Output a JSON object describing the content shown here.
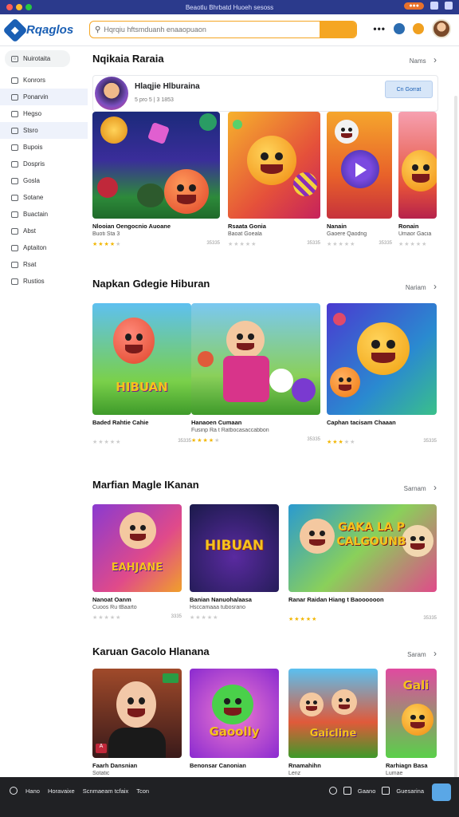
{
  "titlebar": {
    "title": "Beaotlu Bhrbatd Huoeh sesoss"
  },
  "header": {
    "logo": "Rqaglos",
    "search_placeholder": "Hqrqiu hftsmduanh enaaopuaon",
    "menu": "•••"
  },
  "sidebar": {
    "items": [
      {
        "label": "Nuirotaita",
        "icon": "search-icon"
      },
      {
        "label": "Konrors",
        "icon": "grid-icon"
      },
      {
        "label": "Ponarvin",
        "icon": "folder-icon"
      },
      {
        "label": "Hegso",
        "icon": "tag-icon"
      },
      {
        "label": "Stsro",
        "icon": "list-icon"
      },
      {
        "label": "Bupois",
        "icon": "doc-icon"
      },
      {
        "label": "Dospris",
        "icon": "doc-icon"
      },
      {
        "label": "Gosla",
        "icon": "settings-icon"
      },
      {
        "label": "Sotane",
        "icon": "star-icon"
      },
      {
        "label": "Buactain",
        "icon": "chart-icon"
      },
      {
        "label": "Abst",
        "icon": "box-icon"
      },
      {
        "label": "Aptaiton",
        "icon": "user-icon"
      },
      {
        "label": "Rsat",
        "icon": "box-icon"
      },
      {
        "label": "Rustios",
        "icon": "link-icon"
      }
    ]
  },
  "developer": {
    "section_title": "Nqikaia Raraia",
    "see_all": "Nams",
    "name": "Hlaqjie Hlburaina",
    "meta": "5 pro 5 | 3 1853",
    "follow": "Cn Gorrat"
  },
  "sections": [
    {
      "title": "",
      "cards": [
        {
          "title": "Nlooian Oengocnio Auoane",
          "sub": "Buoti Sta 3",
          "rating": 4,
          "meta": "35335"
        },
        {
          "title": "Rsaata Gonia",
          "sub": "Baoat Goeala",
          "rating": 0,
          "meta": "35335"
        },
        {
          "title": "Nanain",
          "sub": "Gaoere Qaodng",
          "rating": 0,
          "meta": "35335"
        },
        {
          "title": "Ronain",
          "sub": "Umaor Gacia",
          "rating": 0,
          "meta": ""
        }
      ]
    },
    {
      "title": "Napkan Gdegie Hiburan",
      "see_all": "Nariam",
      "cards": [
        {
          "title": "Baded Rahtie Cahie",
          "sub": "",
          "rating": 0,
          "meta": "35335",
          "art": "HIBUAN"
        },
        {
          "title": "Hanaoen Cumaan",
          "sub": "Fusinp Ra t Ratbocasaccabbon",
          "rating": 4,
          "meta": "35335"
        },
        {
          "title": "Caphan tacisam Chaaan",
          "sub": "",
          "rating": 3,
          "meta": "35335"
        }
      ]
    },
    {
      "title": "Marfian Magle IKanan",
      "see_all": "Sarnam",
      "cards": [
        {
          "title": "Nanoat Oanm",
          "sub": "Cuoos Ru tBaarto",
          "rating": 0,
          "meta": "3335",
          "art": "EAHJANE"
        },
        {
          "title": "Banian Nanuoha/aasa",
          "sub": "Hsccamaaa tubosrano",
          "rating": 0,
          "meta": "",
          "art": "HIBUAN"
        },
        {
          "title": "Ranar Raidan Hiang t Baoooooon",
          "sub": "",
          "rating": 5,
          "meta": "35335",
          "art": "GAKA LA P CALGOUNB"
        }
      ]
    },
    {
      "title": "Karuan Gacolo Hlanana",
      "see_all": "Saram",
      "cards": [
        {
          "title": "Faarh Dansnian",
          "sub": "Sotatic",
          "rating": 0,
          "meta": "",
          "badge": "A"
        },
        {
          "title": "Benonsar Canonian",
          "sub": "",
          "rating": 0,
          "meta": "",
          "art": "Gaoolly"
        },
        {
          "title": "Rnamahihn",
          "sub": "Lenz",
          "rating": 0,
          "meta": "",
          "art": "Gaicline"
        },
        {
          "title": "Rarhiagn Basa",
          "sub": "Lumae",
          "rating": 0,
          "meta": "",
          "art": "Gali"
        }
      ]
    }
  ],
  "footer": {
    "left": [
      "Hano",
      "Horavaixe",
      "Scnmaeam tcfaix",
      "Tcon"
    ],
    "right": [
      "Gaano",
      "Guesarina"
    ]
  },
  "colors": {
    "accent": "#1a5fb4",
    "search_border": "#f5a623",
    "star": "#f2b705",
    "footer_bg": "#202124"
  }
}
